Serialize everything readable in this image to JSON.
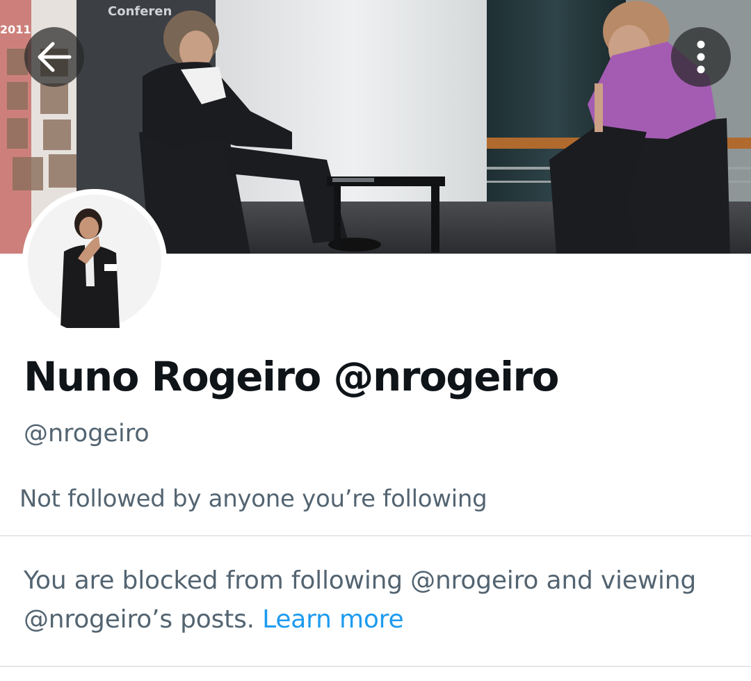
{
  "header": {
    "banner_text_top": "Conferen",
    "banner_text_year": "2011",
    "back_icon": "arrow-left-icon",
    "more_icon": "more-vertical-icon"
  },
  "profile": {
    "display_name": "Nuno Rogeiro @nrogeiro",
    "handle": "@nrogeiro",
    "followed_by": "Not followed by anyone you’re following"
  },
  "blocked": {
    "message": "You are blocked from following @nrogeiro and viewing @nrogeiro’s posts.",
    "link_label": "Learn more"
  },
  "colors": {
    "text_primary": "#0f1419",
    "text_secondary": "#536471",
    "link": "#1d9bf0",
    "divider": "#e4e8eb"
  }
}
